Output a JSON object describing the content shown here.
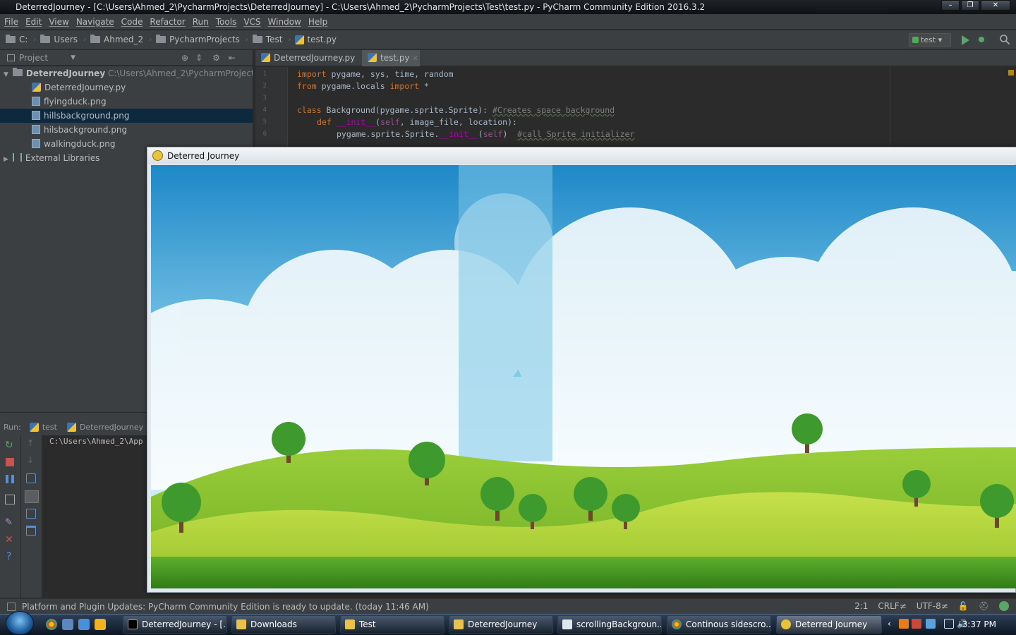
{
  "window": {
    "title": "DeterredJourney - [C:\\Users\\Ahmed_2\\PycharmProjects\\DeterredJourney] - C:\\Users\\Ahmed_2\\PycharmProjects\\Test\\test.py - PyCharm Community Edition 2016.3.2",
    "app_badge": "PC"
  },
  "menu": [
    "File",
    "Edit",
    "View",
    "Navigate",
    "Code",
    "Refactor",
    "Run",
    "Tools",
    "VCS",
    "Window",
    "Help"
  ],
  "breadcrumbs": [
    "C:",
    "Users",
    "Ahmed_2",
    "PycharmProjects",
    "Test",
    "test.py"
  ],
  "run_config": "test",
  "project_panel": {
    "header": "Project",
    "root": {
      "name": "DeterredJourney",
      "path": "C:\\Users\\Ahmed_2\\PycharmProjects\\Det"
    },
    "files": [
      "DeterredJourney.py",
      "flyingduck.png",
      "hillsbackground.png",
      "hilsbackground.png",
      "walkingduck.png"
    ],
    "selected_file": "hillsbackground.png",
    "external": "External Libraries"
  },
  "editor_tabs": [
    "DeterredJourney.py",
    "test.py"
  ],
  "active_tab": "test.py",
  "code": {
    "l1": {
      "kw1": "import",
      "rest": " pygame, sys, time, random"
    },
    "l2": {
      "kw1": "from",
      "mid": " pygame.locals ",
      "kw2": "import",
      "rest": " *"
    },
    "l4": {
      "kw1": "class",
      "rest": " Background(pygame.sprite.Sprite): ",
      "comment": "#Creates space background"
    },
    "l5": {
      "kw1": "def",
      "magic": "__init__",
      "open": "(",
      "self": "self",
      "rest": ", image_file, location):"
    },
    "l6": {
      "pre": "pygame.sprite.Sprite.",
      "magic": "__init__",
      "open": "(",
      "self": "self",
      "close": ")  ",
      "comment": "#call Sprite initializer"
    }
  },
  "run_panel": {
    "label": "Run:",
    "tab1": "test",
    "tab2": "DeterredJourney",
    "console_line": "C:\\Users\\Ahmed_2\\App"
  },
  "game_window": {
    "title": "Deterred Journey"
  },
  "status_bar": {
    "message": "Platform and Plugin Updates: PyCharm Community Edition is ready to update. (today 11:46 AM)",
    "position": "2:1",
    "line_sep": "CRLF≠",
    "encoding": "UTF-8≠"
  },
  "taskbar": {
    "buttons": [
      "DeterredJourney - [...",
      "Downloads",
      "Test",
      "DeterredJourney",
      "scrollingBackgroun...",
      "Continous sidescro...",
      "Deterred Journey"
    ],
    "active_index": 6,
    "clock": "3:37 PM"
  }
}
